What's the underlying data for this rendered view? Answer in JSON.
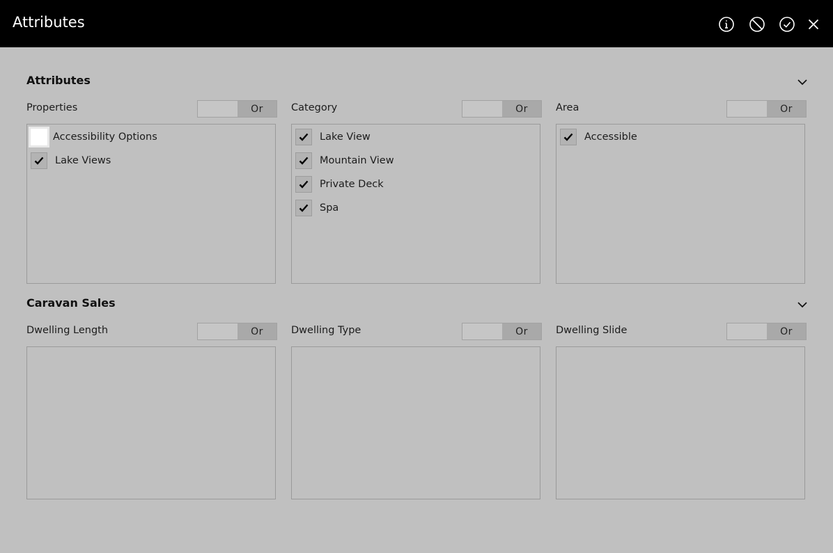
{
  "window": {
    "title": "Attributes",
    "icons": [
      "info-icon",
      "cancel-icon",
      "confirm-icon",
      "close-icon"
    ]
  },
  "sections": [
    {
      "title": "Attributes",
      "panels": [
        {
          "label": "Properties",
          "toggle": "Or",
          "items": [
            {
              "label": "Accessibility Options",
              "checked": false
            },
            {
              "label": "Lake Views",
              "checked": true
            }
          ]
        },
        {
          "label": "Category",
          "toggle": "Or",
          "items": [
            {
              "label": "Lake View",
              "checked": true
            },
            {
              "label": "Mountain View",
              "checked": true
            },
            {
              "label": "Private Deck",
              "checked": true
            },
            {
              "label": "Spa",
              "checked": true
            }
          ]
        },
        {
          "label": "Area",
          "toggle": "Or",
          "items": [
            {
              "label": "Accessible",
              "checked": true
            }
          ]
        }
      ]
    },
    {
      "title": "Caravan Sales",
      "panels": [
        {
          "label": "Dwelling Length",
          "toggle": "Or",
          "items": []
        },
        {
          "label": "Dwelling Type",
          "toggle": "Or",
          "items": []
        },
        {
          "label": "Dwelling Slide",
          "toggle": "Or",
          "items": []
        }
      ]
    }
  ],
  "colors": {
    "titlebar": "#000000",
    "background": "#c0c0c0",
    "toggle_on": "#a9a9a9",
    "checkbox_checked": "#b3b3b3",
    "checkbox_unchecked": "#ffffff"
  }
}
